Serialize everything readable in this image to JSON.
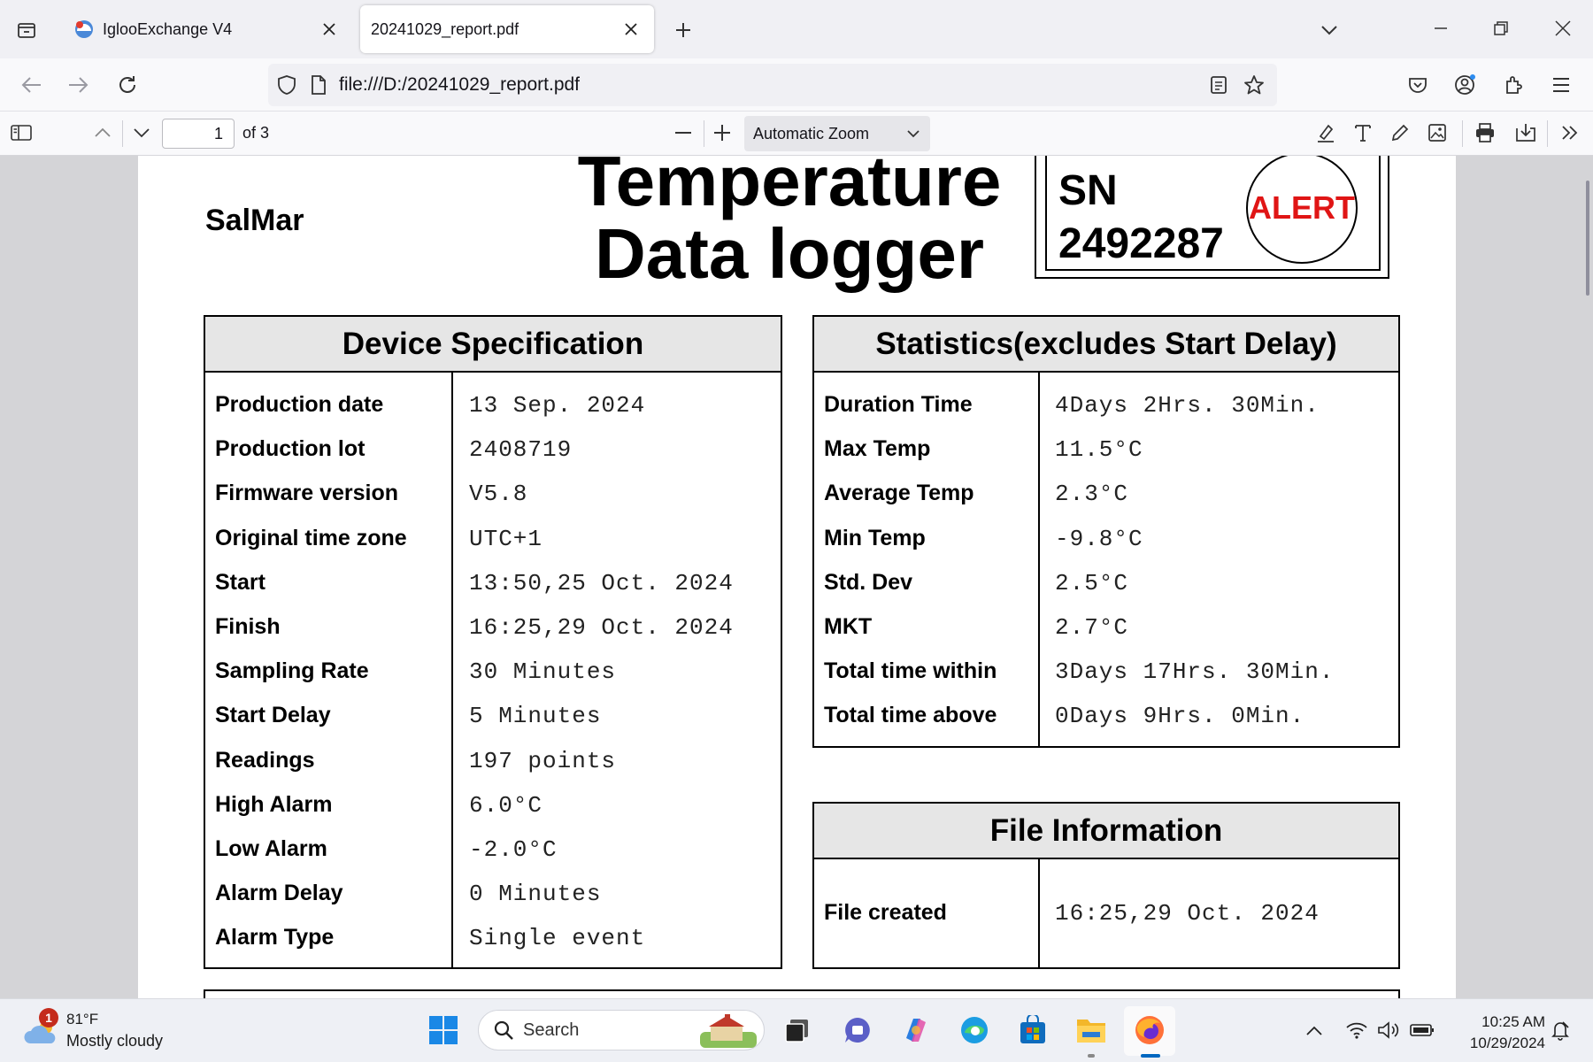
{
  "browser": {
    "tabs": [
      {
        "title": "IglooExchange V4",
        "active": false
      },
      {
        "title": "20241029_report.pdf",
        "active": true
      }
    ],
    "url": "file:///D:/20241029_report.pdf"
  },
  "pdf_toolbar": {
    "page_number": "1",
    "page_count_label": "of 3",
    "zoom": "Automatic Zoom"
  },
  "report": {
    "company": "SalMar",
    "title_line1": "Temperature",
    "title_line2": "Data logger",
    "sn_label": "SN",
    "sn_value": "2492287",
    "alert": "ALERT",
    "device_spec": {
      "heading": "Device Specification",
      "rows": [
        {
          "label": "Production date",
          "value": "13 Sep. 2024"
        },
        {
          "label": "Production lot",
          "value": "2408719"
        },
        {
          "label": "Firmware version",
          "value": "V5.8"
        },
        {
          "label": "Original time zone",
          "value": "UTC+1"
        },
        {
          "label": "Start",
          "value": "13:50,25 Oct. 2024"
        },
        {
          "label": "Finish",
          "value": "16:25,29 Oct. 2024"
        },
        {
          "label": "Sampling Rate",
          "value": "30 Minutes"
        },
        {
          "label": "Start Delay",
          "value": "5 Minutes"
        },
        {
          "label": "Readings",
          "value": "197 points"
        },
        {
          "label": "High Alarm",
          "value": "6.0°C"
        },
        {
          "label": "Low Alarm",
          "value": "-2.0°C"
        },
        {
          "label": "Alarm Delay",
          "value": "0 Minutes"
        },
        {
          "label": "Alarm Type",
          "value": "Single event"
        }
      ]
    },
    "statistics": {
      "heading": "Statistics(excludes Start Delay)",
      "rows": [
        {
          "label": "Duration Time",
          "value": "4Days 2Hrs. 30Min."
        },
        {
          "label": "Max Temp",
          "value": "11.5°C"
        },
        {
          "label": "Average Temp",
          "value": "2.3°C"
        },
        {
          "label": "Min Temp",
          "value": "-9.8°C"
        },
        {
          "label": "Std. Dev",
          "value": "2.5°C"
        },
        {
          "label": "MKT",
          "value": "2.7°C"
        },
        {
          "label": "Total time within",
          "value": "3Days 17Hrs. 30Min."
        },
        {
          "label": "Total time above",
          "value": "0Days 9Hrs. 0Min."
        }
      ]
    },
    "file_info": {
      "heading": "File Information",
      "rows": [
        {
          "label": "File created",
          "value": "16:25,29 Oct. 2024"
        }
      ]
    }
  },
  "taskbar": {
    "weather_temp": "81°F",
    "weather_desc": "Mostly cloudy",
    "weather_badge": "1",
    "search_placeholder": "Search",
    "time": "10:25 AM",
    "date": "10/29/2024"
  },
  "colors": {
    "alert_red": "#e01515",
    "table_header_bg": "#e6e6e6",
    "viewer_bg": "#d4d4d7"
  }
}
